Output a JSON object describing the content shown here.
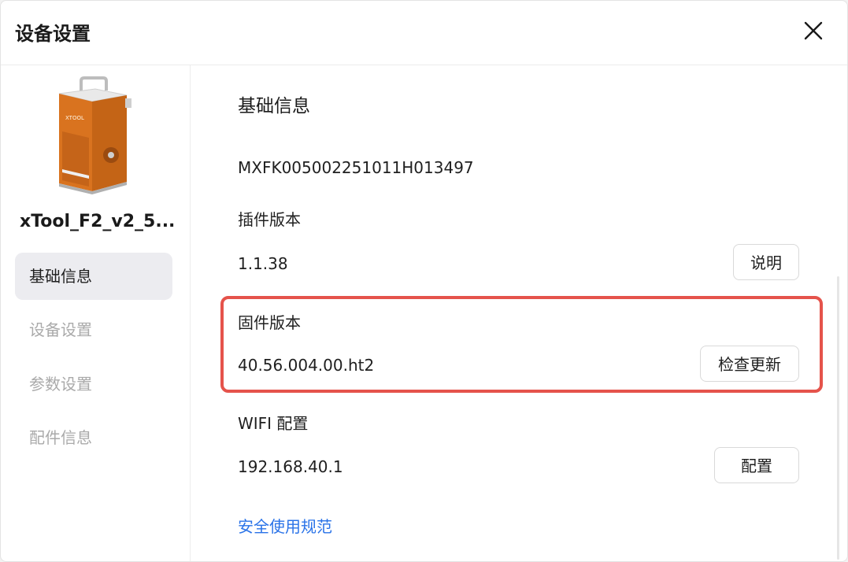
{
  "dialog": {
    "title": "设备设置",
    "close_icon": "close-icon"
  },
  "sidebar": {
    "device_name": "xTool_F2_v2_5...",
    "device_image": "laser-engraver-device",
    "items": [
      {
        "label": "基础信息",
        "active": true
      },
      {
        "label": "设备设置",
        "active": false
      },
      {
        "label": "参数设置",
        "active": false
      },
      {
        "label": "配件信息",
        "active": false
      }
    ]
  },
  "main": {
    "section_title": "基础信息",
    "serial_number": "MXFK005002251011H013497",
    "plugin": {
      "label": "插件版本",
      "value": "1.1.38",
      "button_label": "说明"
    },
    "firmware": {
      "label": "固件版本",
      "value": "40.56.004.00.ht2",
      "button_label": "检查更新"
    },
    "wifi": {
      "label": "WIFI 配置",
      "value": "192.168.40.1",
      "button_label": "配置"
    },
    "safety_link": "安全使用规范"
  },
  "colors": {
    "highlight": "#e5534b",
    "link": "#2a73e8",
    "active_nav_bg": "#ececf0"
  }
}
